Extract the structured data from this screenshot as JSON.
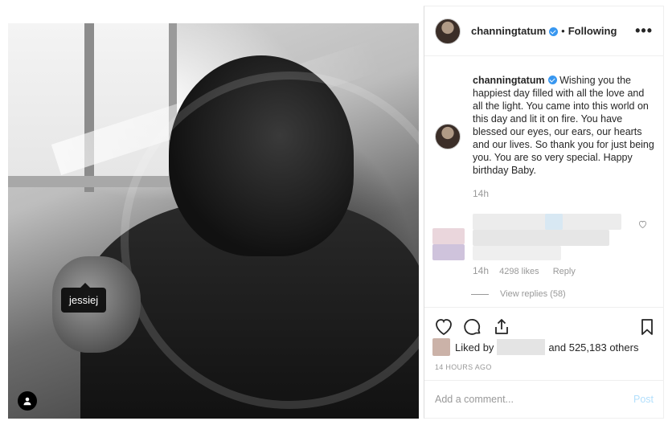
{
  "photo": {
    "tag_label": "jessiej"
  },
  "header": {
    "username": "channingtatum",
    "separator": "•",
    "follow_state": "Following",
    "more_glyph": "•••"
  },
  "caption": {
    "username": "channingtatum",
    "text": "Wishing you the happiest day filled with all the love and all the light. You came into this world on this day and lit it on fire. You have blessed our eyes, our ears, our hearts and our lives. So thank you for just being you. You are so very special. Happy birthday Baby.",
    "time": "14h"
  },
  "comment": {
    "time": "14h",
    "likes": "4298 likes",
    "reply": "Reply",
    "view_replies": "View replies (58)"
  },
  "likes": {
    "prefix": "Liked by",
    "suffix": "and 525,183 others"
  },
  "timestamp": "14 HOURS AGO",
  "add_comment": {
    "placeholder": "Add a comment...",
    "post_label": "Post"
  },
  "colors": {
    "accent": "#3897f0",
    "post_disabled": "#b2dffc"
  }
}
